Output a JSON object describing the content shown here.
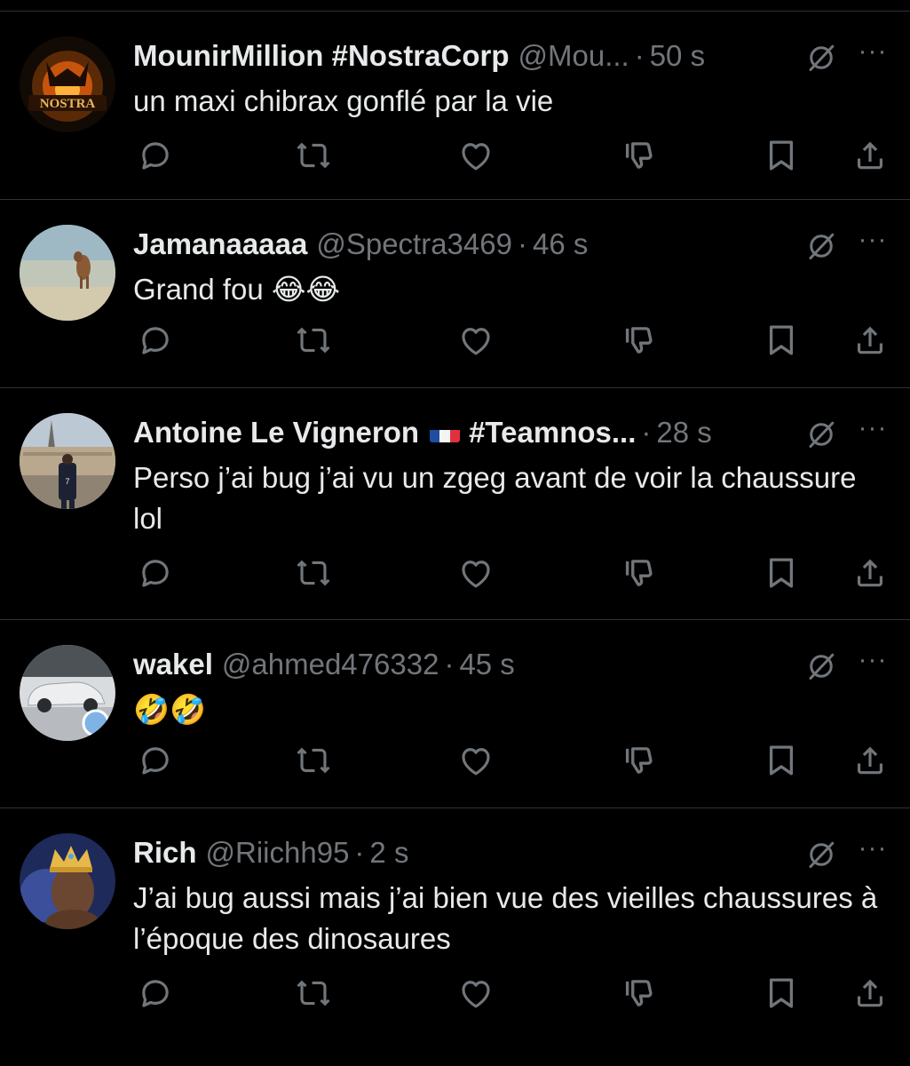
{
  "theme": {
    "background": "#000000",
    "text": "#e7e9ea",
    "muted": "#71767b",
    "divider": "#2f3336"
  },
  "tweets": [
    {
      "name": "MounirMillion #NostraCorp",
      "handle": "@Mou...",
      "time": "50 s",
      "text": "un maxi chibrax gonflé par la vie",
      "avatar_label": "NOSTRA",
      "avatar_icon": "nostra-logo"
    },
    {
      "name": "Jamanaaaaa",
      "handle": "@Spectra3469",
      "time": "46 s",
      "text": "Grand fou 😂😂",
      "avatar_icon": "beach-dog-photo"
    },
    {
      "name": "Antoine Le Vigneron",
      "flag": "fr-flag",
      "handle": "#Teamnos...",
      "time": "28 s",
      "text": "Perso j’ai bug j’ai vu un zgeg avant de voir la chaussure lol",
      "avatar_icon": "paris-photo"
    },
    {
      "name": "wakel",
      "handle": "@ahmed476332",
      "time": "45 s",
      "text": "🤣🤣",
      "avatar_icon": "car-photo"
    },
    {
      "name": "Rich",
      "handle": "@Riichh95",
      "time": "2 s",
      "text": "J’ai bug aussi mais j’ai bien vue des vieilles chaussures à l’époque des dinosaures",
      "avatar_icon": "crowned-king-art"
    }
  ],
  "separator": "·",
  "more_label": "···",
  "action_icons": [
    "reply-icon",
    "retweet-icon",
    "like-icon",
    "dislike-icon",
    "bookmark-icon",
    "share-icon"
  ]
}
